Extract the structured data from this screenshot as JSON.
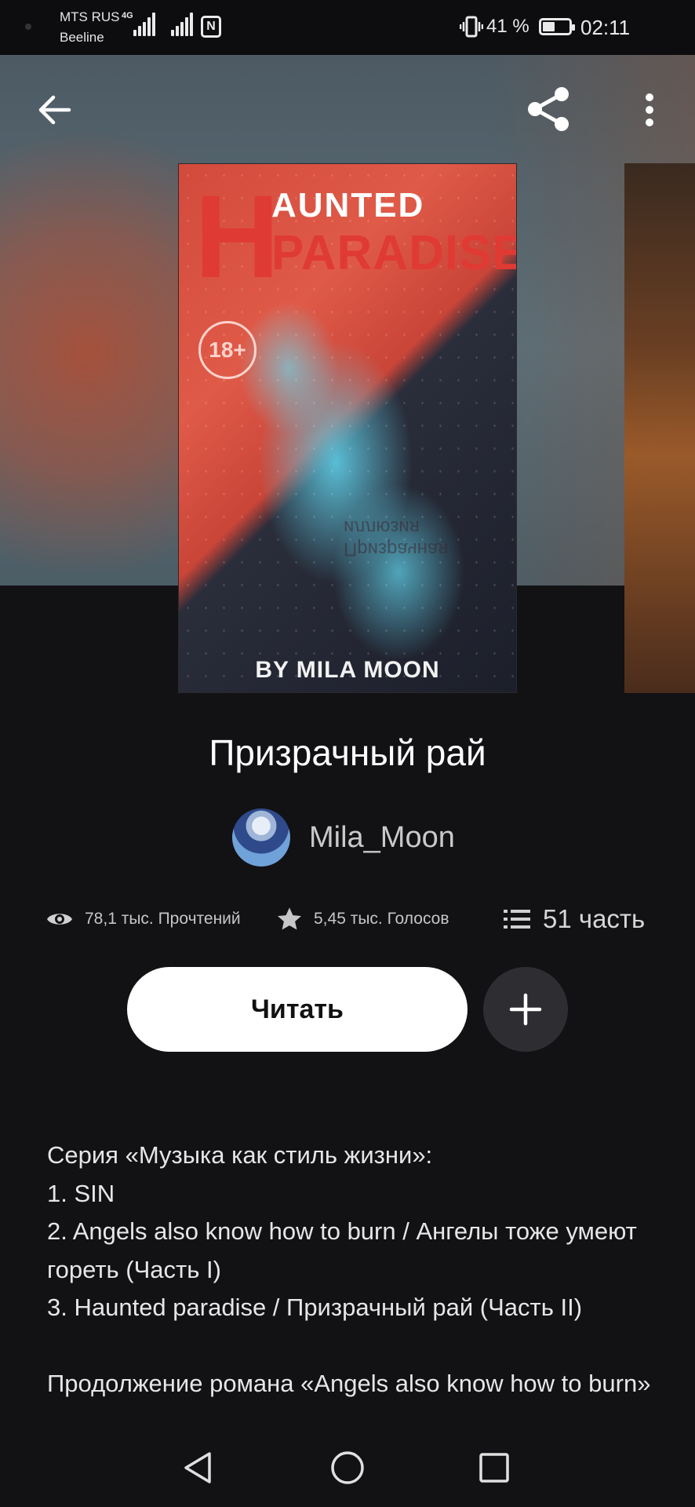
{
  "status_bar": {
    "carrier_primary": "MTS RUS",
    "carrier_secondary": "Beeline",
    "network": "4G",
    "battery_percent": "41 %",
    "battery_level": 0.41,
    "time": "02:11"
  },
  "header": {
    "back_icon": "arrow-left-icon",
    "share_icon": "share-icon",
    "more_icon": "more-vertical-icon"
  },
  "cover": {
    "title_line1": "AUNTED",
    "title_letter": "H",
    "title_line2": "PARADISE",
    "age_rating": "18+",
    "mid_text": "Призрачная иллюзия",
    "byline": "BY MILA MOON"
  },
  "story": {
    "title": "Призрачный рай",
    "author": "Mila_Moon",
    "reads": "78,1 тыс. Прочтений",
    "votes": "5,45 тыс. Голосов",
    "parts": "51 часть"
  },
  "actions": {
    "read_label": "Читать",
    "add_icon": "plus-icon"
  },
  "description": {
    "lines": [
      "Серия «Музыка как стиль жизни»:",
      "1. SIN",
      "2. Angels also know how to burn / Ангелы тоже умеют гореть  (Часть I)",
      "3. Haunted paradise / Призрачный рай (Часть II)",
      "",
      "Продолжение романа «Angels also know how to burn»"
    ]
  },
  "nav": {
    "back_icon": "triangle-back-icon",
    "home_icon": "circle-home-icon",
    "recents_icon": "square-recents-icon"
  },
  "colors": {
    "background": "#121114",
    "accent_red": "#e03a34",
    "button_bg": "#ffffff",
    "add_button_bg": "#2e2e32"
  }
}
